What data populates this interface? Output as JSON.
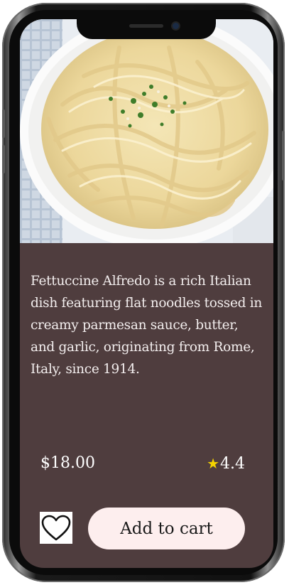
{
  "product": {
    "description": "Fettuccine Alfredo is a rich Italian dish featuring flat noodles tossed in creamy parmesan sauce, butter, and garlic, originating from Rome, Italy, since 1914.",
    "price": "$18.00",
    "rating": "4.4",
    "rating_icon": "star-icon",
    "image_alt": "fettuccine-alfredo-photo"
  },
  "actions": {
    "favorite_icon": "heart-icon",
    "add_to_cart_label": "Add to cart"
  },
  "colors": {
    "card_background": "#4f3d3e",
    "button_background": "#fdeeee",
    "star": "#f4d300",
    "text": "#ffffff"
  }
}
